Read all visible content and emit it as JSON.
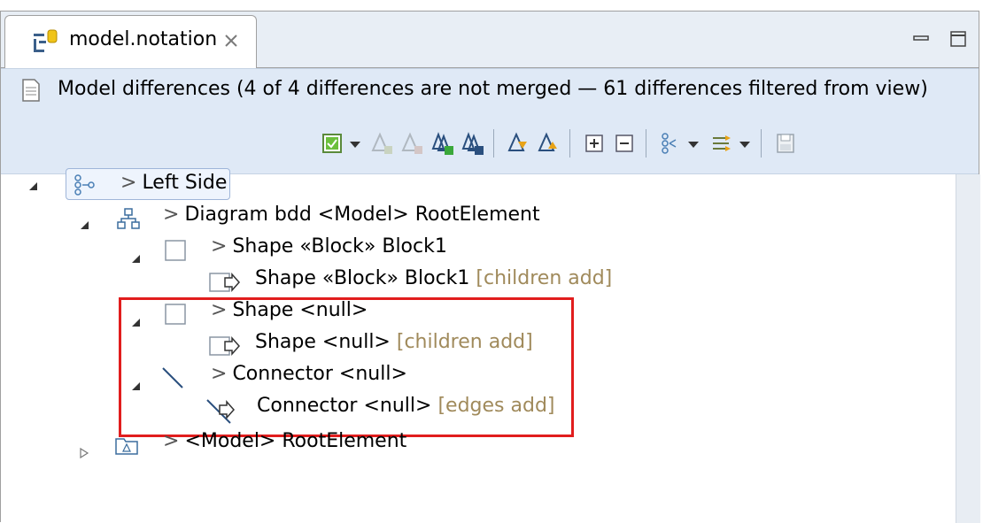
{
  "tab": {
    "title": "model.notation",
    "icon": "notation-file-icon"
  },
  "header": {
    "text": "Model differences  (4 of 4 differences are not merged — 61 differences filtered from view)"
  },
  "toolbar": {
    "items": [
      "select-all-checkbox-icon",
      "dropdown-arrow-icon",
      "accept-change-icon",
      "reject-change-icon",
      "accept-all-icon",
      "reject-all-icon",
      "next-difference-icon",
      "previous-difference-icon",
      "expand-all-icon",
      "collapse-all-icon",
      "group-icon",
      "dropdown-arrow-icon",
      "filter-icon",
      "dropdown-arrow-icon",
      "save-icon"
    ]
  },
  "tree": {
    "left_side": {
      "prefix": ">",
      "label": "Left Side"
    },
    "diagram": {
      "prefix": ">",
      "label": "Diagram bdd <Model> RootElement"
    },
    "shape_block": {
      "prefix": ">",
      "label": "Shape «Block» Block1"
    },
    "shape_block_child": {
      "label": "Shape «Block» Block1",
      "annotation": "[children add]"
    },
    "shape_null": {
      "prefix": ">",
      "label": "Shape <null>"
    },
    "shape_null_child": {
      "label": "Shape <null>",
      "annotation": "[children add]"
    },
    "connector_null": {
      "prefix": ">",
      "label": "Connector <null>"
    },
    "connector_null_child": {
      "label": "Connector <null>",
      "annotation": "[edges add]"
    },
    "model_root": {
      "prefix": ">",
      "label": "<Model> RootElement"
    }
  },
  "colors": {
    "highlight_border": "#e11d1d",
    "annotation_text": "#a08a5b",
    "header_bg": "#dfe9f6"
  }
}
